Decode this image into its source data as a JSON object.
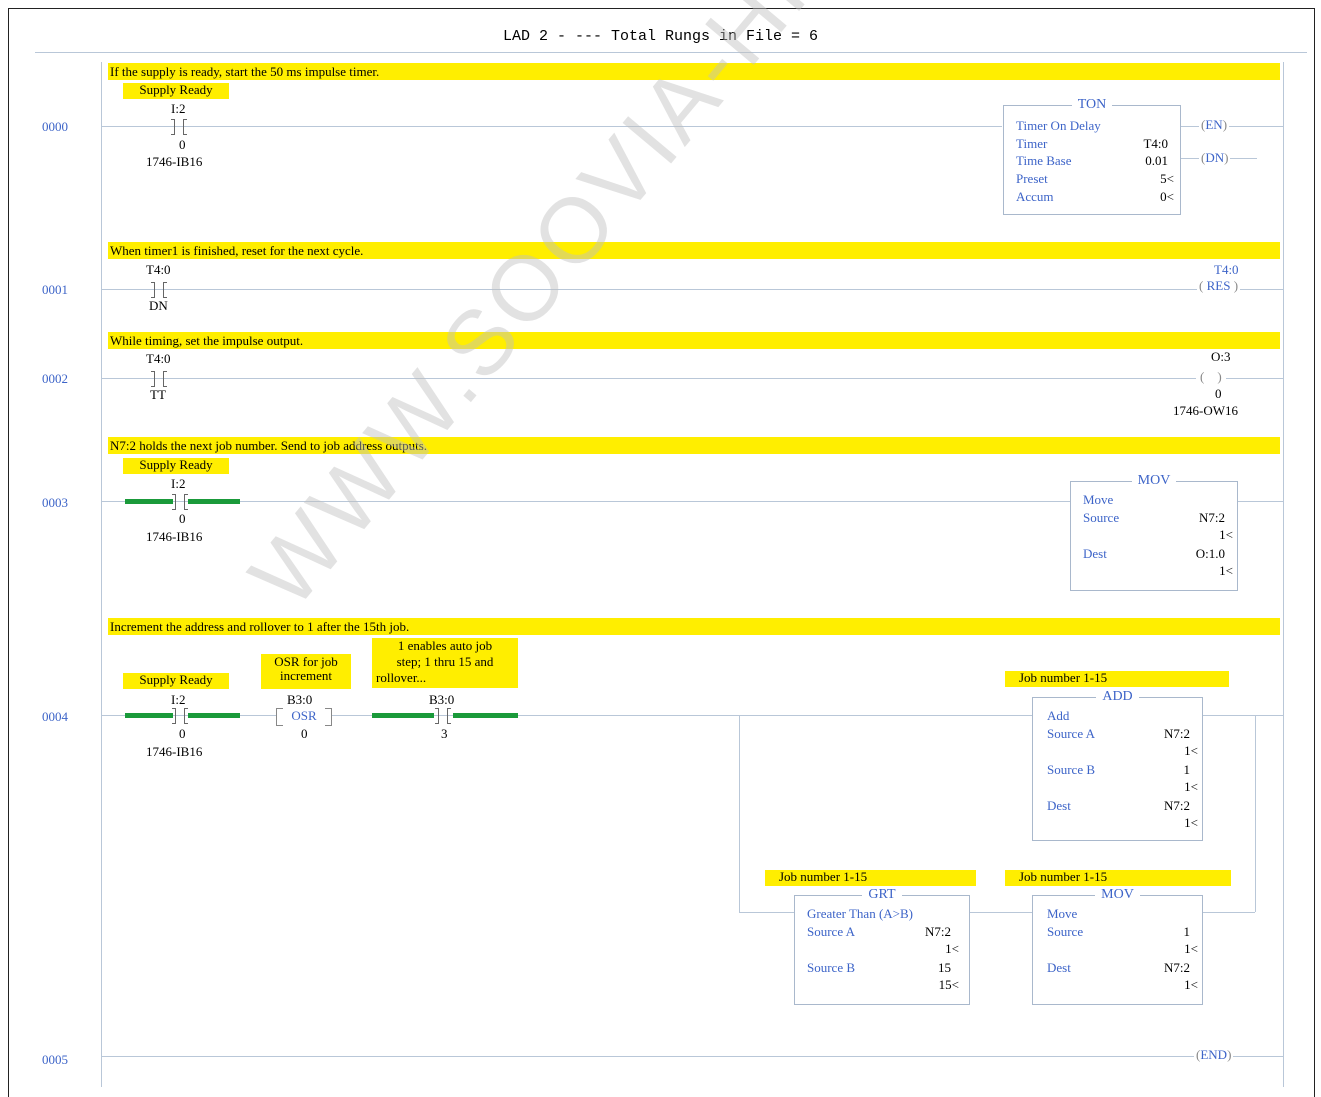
{
  "header": {
    "title": "LAD 2 -   --- Total Rungs in File = 6"
  },
  "watermark": "WWW.SOOVIA-HK.CO",
  "colors": {
    "rung_number": "#3d64c8",
    "comment_bg": "#ffee00",
    "energized": "#1a9a3a",
    "instruction_text": "#3d64c8"
  },
  "rungs": [
    {
      "number": "0000",
      "comment": "If the supply is ready, start the 50 ms impulse timer.",
      "contact": {
        "desc": "Supply Ready",
        "addr": "I:2",
        "bit": "0",
        "module": "1746-IB16"
      },
      "ton": {
        "name": "TON",
        "subtitle": "Timer On Delay",
        "rows": [
          {
            "k": "Timer",
            "v": "T4:0"
          },
          {
            "k": "Time Base",
            "v": "0.01"
          },
          {
            "k": "Preset",
            "v": "5<"
          },
          {
            "k": "Accum",
            "v": "0<"
          }
        ],
        "coil_en": "EN",
        "coil_dn": "DN"
      }
    },
    {
      "number": "0001",
      "comment": "When timer1 is finished, reset for the next cycle.",
      "contact": {
        "addr": "T4:0",
        "bit": "DN"
      },
      "coil": {
        "addr": "T4:0",
        "name": "RES"
      }
    },
    {
      "number": "0002",
      "comment": "While timing, set the impulse output.",
      "contact": {
        "addr": "T4:0",
        "bit": "TT"
      },
      "coil": {
        "addr": "O:3",
        "bit": "0",
        "module": "1746-OW16"
      }
    },
    {
      "number": "0003",
      "comment": "N7:2 holds the next job number.  Send to job address outputs.",
      "contact": {
        "desc": "Supply Ready",
        "addr": "I:2",
        "bit": "0",
        "module": "1746-IB16"
      },
      "mov": {
        "name": "MOV",
        "subtitle": "Move",
        "source_label": "Source",
        "source_addr": "N7:2",
        "source_val": "1<",
        "dest_label": "Dest",
        "dest_addr": "O:1.0",
        "dest_val": "1<"
      }
    },
    {
      "number": "0004",
      "comment": "Increment the address and rollover to 1 after the 15th job.",
      "contact": {
        "desc": "Supply Ready",
        "addr": "I:2",
        "bit": "0",
        "module": "1746-IB16"
      },
      "osr": {
        "desc_l1": "OSR for job",
        "desc_l2": "increment",
        "addr": "B3:0",
        "name": "OSR",
        "bit": "0"
      },
      "contact2": {
        "desc_l1": "1 enables auto job",
        "desc_l2": "step; 1 thru 15 and",
        "desc_l3": "rollover...",
        "addr": "B3:0",
        "bit": "3"
      },
      "add": {
        "desc": "Job number 1-15",
        "name": "ADD",
        "subtitle": "Add",
        "a_label": "Source A",
        "a_addr": "N7:2",
        "a_val": "1<",
        "b_label": "Source B",
        "b_addr": "1",
        "b_val": "1<",
        "d_label": "Dest",
        "d_addr": "N7:2",
        "d_val": "1<"
      },
      "grt": {
        "desc": "Job number 1-15",
        "name": "GRT",
        "subtitle": "Greater Than (A>B)",
        "a_label": "Source A",
        "a_addr": "N7:2",
        "a_val": "1<",
        "b_label": "Source B",
        "b_addr": "15",
        "b_val": "15<"
      },
      "mov2": {
        "desc": "Job number 1-15",
        "name": "MOV",
        "subtitle": "Move",
        "s_label": "Source",
        "s_addr": "1",
        "s_val": "1<",
        "d_label": "Dest",
        "d_addr": "N7:2",
        "d_val": "1<"
      }
    },
    {
      "number": "0005",
      "coil": {
        "name": "END"
      }
    }
  ]
}
